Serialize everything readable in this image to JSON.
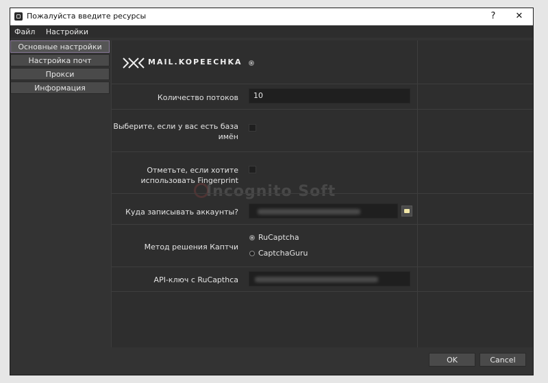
{
  "window": {
    "title": "Пожалуйста введите ресурсы",
    "help_label": "?",
    "close_label": "✕"
  },
  "menu": [
    "Файл",
    "Настройки"
  ],
  "sidebar": {
    "items": [
      {
        "label": "Основные настройки",
        "active": true
      },
      {
        "label": "Настройка почт",
        "active": false
      },
      {
        "label": "Прокси",
        "active": false
      },
      {
        "label": "Информация",
        "active": false
      }
    ]
  },
  "logo": {
    "text": "MAIL.KOPEECHKA"
  },
  "form": {
    "threads_label": "Количество потоков",
    "threads_value": "10",
    "names_db_label": "Выберите, если у вас есть база имён",
    "fingerprint_label": "Отметьте, если хотите использовать Fingerprint",
    "save_path_label": "Куда записывать аккаунты?",
    "captcha_method_label": "Метод решения Каптчи",
    "captcha_options": [
      {
        "label": "RuCaptcha",
        "selected": true
      },
      {
        "label": "CaptchaGuru",
        "selected": false
      }
    ],
    "api_key_label": "API-ключ с RuCapthca"
  },
  "watermark": {
    "text": "Incognito Soft"
  },
  "buttons": {
    "ok": "OK",
    "cancel": "Cancel"
  },
  "icons": [
    "app-icon",
    "help-icon",
    "close-icon",
    "logo-icon",
    "folder-icon"
  ]
}
